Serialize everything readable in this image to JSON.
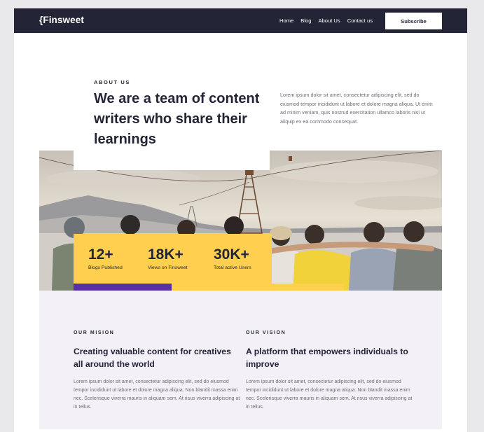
{
  "nav": {
    "logo": "{Finsweet",
    "links": [
      "Home",
      "Blog",
      "About Us",
      "Contact us"
    ],
    "subscribe": "Subscribe"
  },
  "hero": {
    "eyebrow": "ABOUT US",
    "title": "We are a team of content writers who share their learnings",
    "description": "Lorem ipsum dolor sit amet, consectetur adipiscing elit, sed do eiusmod tempor incididunt ut labore et dolore magna aliqua. Ut enim ad minim veniam, quis nostrud exercitation ullamco laboris nisi ut aliquip ex ea commodo consequat."
  },
  "stats": [
    {
      "value": "12+",
      "label": "Blogs Published"
    },
    {
      "value": "18K+",
      "label": "Views on Finsweet"
    },
    {
      "value": "30K+",
      "label": "Total active Users"
    }
  ],
  "mission": {
    "eyebrow": "OUR MISION",
    "title": "Creating valuable content for creatives all around the world",
    "text": "Lorem ipsum dolor sit amet, consectetur adipiscing elit, sed do eiusmod tempor incididunt ut labore et dolore magna aliqua. Non blandit massa enim nec. Scelerisque viverra mauris in aliquam sem. At risus viverra adipiscing at in tellus."
  },
  "vision": {
    "eyebrow": "OUR VISION",
    "title": "A platform that empowers individuals to improve",
    "text": "Lorem ipsum dolor sit amet, consectetur adipiscing elit, sed do eiusmod tempor incididunt ut labore et dolore magna aliqua. Non blandit massa enim nec. Scelerisque viverra mauris in aliquam sem. At risus viverra adipiscing at in tellus."
  },
  "colors": {
    "navy": "#232536",
    "yellow": "#ffd050",
    "purple": "#592ea9",
    "lavender": "#f4f0f8"
  }
}
